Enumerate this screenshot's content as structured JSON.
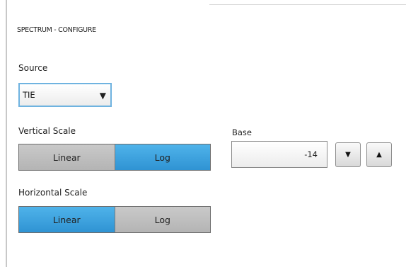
{
  "panel": {
    "title": "SPECTRUM - CONFIGURE"
  },
  "source": {
    "label": "Source",
    "selected": "TIE",
    "arrow_icon": "dropdown-triangle-icon"
  },
  "vertical_scale": {
    "label": "Vertical Scale",
    "options": [
      "Linear",
      "Log"
    ],
    "selected": "Log"
  },
  "horizontal_scale": {
    "label": "Horizontal Scale",
    "options": [
      "Linear",
      "Log"
    ],
    "selected": "Linear"
  },
  "base": {
    "label": "Base",
    "value": "-14",
    "decrement_icon": "triangle-down-icon",
    "increment_icon": "triangle-up-icon"
  },
  "colors": {
    "selected": "#3aa3df",
    "unselected": "#bdbdbd",
    "focus_border": "#6fb3e0"
  }
}
